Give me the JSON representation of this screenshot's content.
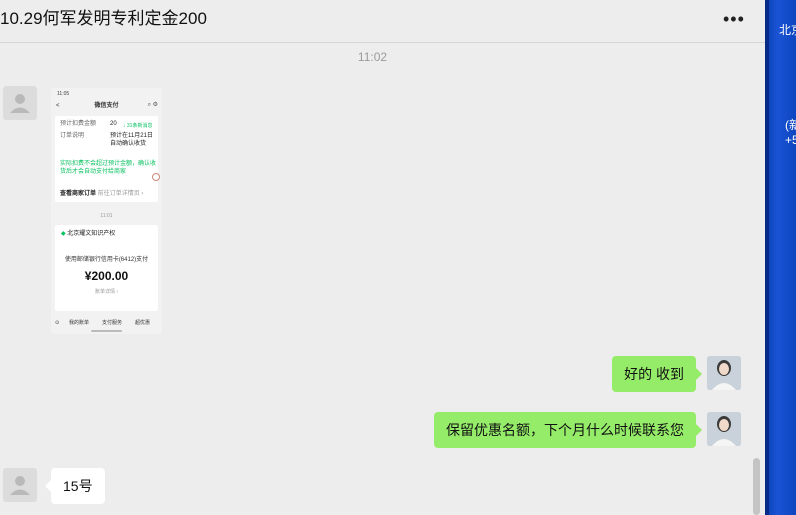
{
  "header": {
    "title": "10.29何军发明专利定金200",
    "more_label": "•••"
  },
  "time_divider": "11:02",
  "screenshot": {
    "status_time": "11:05",
    "back_label": "<",
    "page_title": "微信支付",
    "nav_icons": "⌕ ⚙",
    "fee_label": "预计扣费金额",
    "fee_value": "20",
    "new_messages": "↓ 31条新消息",
    "order_label": "订单说明",
    "order_value": "预计在11月21日自动确认收货",
    "notice": "实际扣费不会超过预计金额，确认收货后才会自动支付给商家",
    "view_order_label": "查看商家订单",
    "view_order_hint": "前往订单详情页 ›",
    "time_mid": "11:01",
    "merchant": "北京耀文知识产权",
    "pay_method": "使用邮储银行信用卡(6412)支付",
    "amount": "¥200.00",
    "bill_detail": "账单详情 ›",
    "tabs": [
      "我的账单",
      "支付服务",
      "超优惠"
    ]
  },
  "messages": [
    {
      "side": "right",
      "text": "好的 收到"
    },
    {
      "side": "right",
      "text": "保留优惠名额，下个月什么时候联系您"
    },
    {
      "side": "left",
      "text": "15号"
    }
  ],
  "desktop": {
    "label_1": "北京",
    "label_2": "(新",
    "label_3": "+5"
  },
  "colors": {
    "bubble_green": "#95ec69",
    "wechat_green": "#07c160",
    "desktop_blue": "#1a54d4"
  }
}
